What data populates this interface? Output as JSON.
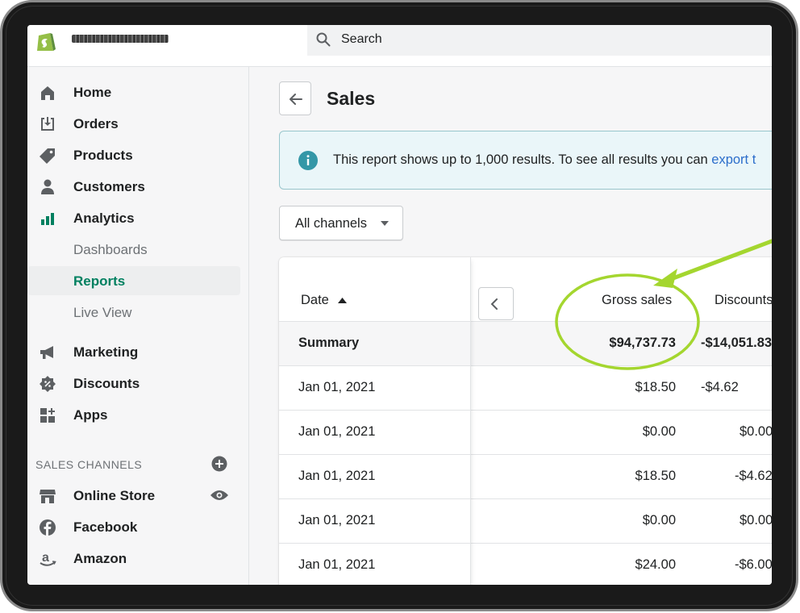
{
  "topbar": {
    "search_placeholder": "Search"
  },
  "sidebar": {
    "items": [
      {
        "label": "Home",
        "icon": "home-icon"
      },
      {
        "label": "Orders",
        "icon": "orders-icon"
      },
      {
        "label": "Products",
        "icon": "tag-icon"
      },
      {
        "label": "Customers",
        "icon": "person-icon"
      },
      {
        "label": "Analytics",
        "icon": "bar-chart-icon"
      }
    ],
    "analytics_sub": [
      {
        "label": "Dashboards"
      },
      {
        "label": "Reports",
        "active": true
      },
      {
        "label": "Live View"
      }
    ],
    "items2": [
      {
        "label": "Marketing",
        "icon": "megaphone-icon"
      },
      {
        "label": "Discounts",
        "icon": "discount-icon"
      },
      {
        "label": "Apps",
        "icon": "apps-icon"
      }
    ],
    "sales_channels_title": "SALES CHANNELS",
    "channels": [
      {
        "label": "Online Store",
        "icon": "store-icon"
      },
      {
        "label": "Facebook",
        "icon": "facebook-icon"
      },
      {
        "label": "Amazon",
        "icon": "amazon-icon"
      }
    ]
  },
  "main": {
    "title": "Sales",
    "banner": {
      "text": "This report shows up to 1,000 results. To see all results you can ",
      "link": "export t"
    },
    "channel_select": "All channels",
    "table": {
      "col_date": "Date",
      "col_gross": "Gross sales",
      "col_discounts": "Discounts",
      "summary": {
        "date": "Summary",
        "gross": "$94,737.73",
        "discounts": "-$14,051.83"
      },
      "rows": [
        {
          "date": "Jan 01, 2021",
          "gross": "$18.50",
          "discounts": "-$4.62"
        },
        {
          "date": "Jan 01, 2021",
          "gross": "$0.00",
          "discounts": "$0.00"
        },
        {
          "date": "Jan 01, 2021",
          "gross": "$18.50",
          "discounts": "-$4.62"
        },
        {
          "date": "Jan 01, 2021",
          "gross": "$0.00",
          "discounts": "$0.00"
        },
        {
          "date": "Jan 01, 2021",
          "gross": "$24.00",
          "discounts": "-$6.00"
        }
      ]
    }
  },
  "colors": {
    "accent_green": "#008060",
    "annotation": "#a4d62f",
    "link_blue": "#2c6ecb",
    "info_teal": "#3497a7"
  }
}
